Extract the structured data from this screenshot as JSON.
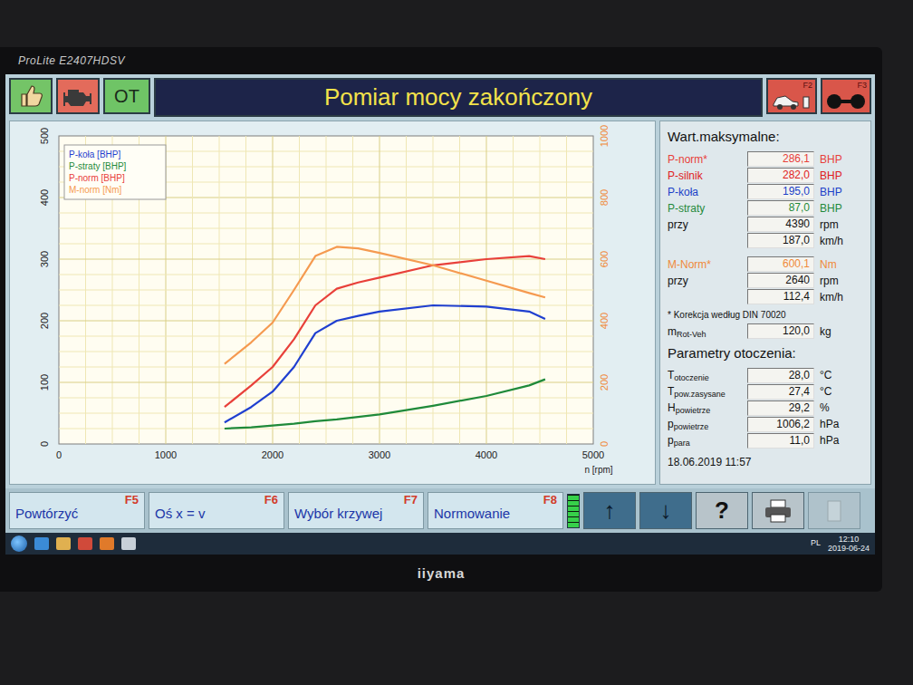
{
  "monitor": {
    "model": "ProLite E2407HDSV",
    "brand": "iiyama"
  },
  "toolbar": {
    "ot_label": "OT",
    "title": "Pomiar mocy zakończony",
    "f2_key": "F2",
    "f3_key": "F3"
  },
  "chart": {
    "y_ticks": [
      "0",
      "100",
      "200",
      "300",
      "400",
      "500"
    ],
    "y2_ticks": [
      "0",
      "200",
      "400",
      "600",
      "800",
      "1000"
    ],
    "x_ticks": [
      "0",
      "1000",
      "2000",
      "3000",
      "4000",
      "5000"
    ],
    "x_label": "n [rpm]",
    "rpm": [
      1550,
      1800,
      2000,
      2200,
      2400,
      2600,
      2800,
      3000,
      3500,
      4000,
      4400,
      4550
    ],
    "series": [
      {
        "legend": "P-koła [BHP]",
        "color": "#1f3fd0",
        "axis": "left",
        "values": [
          35,
          60,
          85,
          125,
          180,
          200,
          208,
          215,
          225,
          223,
          215,
          203
        ]
      },
      {
        "legend": "P-straty [BHP]",
        "color": "#1f8a3a",
        "axis": "left",
        "values": [
          25,
          27,
          30,
          33,
          37,
          40,
          44,
          48,
          62,
          78,
          95,
          105
        ]
      },
      {
        "legend": "P-norm [BHP]",
        "color": "#e8403a",
        "axis": "left",
        "values": [
          60,
          95,
          125,
          170,
          225,
          252,
          262,
          270,
          290,
          300,
          305,
          300
        ]
      },
      {
        "legend": "M-norm [Nm]",
        "color": "#f59a50",
        "axis": "right",
        "values": [
          260,
          330,
          394,
          500,
          610,
          640,
          635,
          620,
          580,
          530,
          490,
          476
        ]
      }
    ]
  },
  "maxima": {
    "title": "Wart.maksymalne:",
    "power_rows": [
      {
        "label": "P-norm*",
        "value": "286,1",
        "unit": "BHP",
        "color": "#e8403a"
      },
      {
        "label": "P-silnik",
        "value": "282,0",
        "unit": "BHP",
        "color": "#e02020"
      },
      {
        "label": "P-koła",
        "value": "195,0",
        "unit": "BHP",
        "color": "#1a3fc8"
      },
      {
        "label": "P-straty",
        "value": "87,0",
        "unit": "BHP",
        "color": "#1f8a3a"
      },
      {
        "label": "przy",
        "value": "4390",
        "unit": "rpm",
        "color": "#111111"
      },
      {
        "value": "187,0",
        "unit": "km/h",
        "color": "#111111"
      }
    ],
    "torque_rows": [
      {
        "label": "M-Norm*",
        "value": "600,1",
        "unit": "Nm",
        "color": "#f08a3a"
      },
      {
        "label": "przy",
        "value": "2640",
        "unit": "rpm",
        "color": "#111111"
      },
      {
        "value": "112,4",
        "unit": "km/h",
        "color": "#111111"
      }
    ],
    "note": "* Korekcja według DIN 70020",
    "mass": {
      "label": "m",
      "sub": "Rot-Veh",
      "value": "120,0",
      "unit": "kg"
    }
  },
  "ambient": {
    "title": "Parametry otoczenia:",
    "rows": [
      {
        "label": "T",
        "sub": "otoczenie",
        "value": "28,0",
        "unit": "°C"
      },
      {
        "label": "T",
        "sub": "pow.zasysane",
        "value": "27,4",
        "unit": "°C"
      },
      {
        "label": "H",
        "sub": "powietrze",
        "value": "29,2",
        "unit": "%"
      },
      {
        "label": "p",
        "sub": "powietrze",
        "value": "1006,2",
        "unit": "hPa"
      },
      {
        "label": "p",
        "sub": "para",
        "value": "11,0",
        "unit": "hPa"
      }
    ]
  },
  "timestamp": "18.06.2019 11:57",
  "function_keys": [
    {
      "label": "Powtórzyć",
      "key": "F5"
    },
    {
      "label": "Oś x = v",
      "key": "F6"
    },
    {
      "label": "Wybór krzywej",
      "key": "F7"
    },
    {
      "label": "Normowanie",
      "key": "F8"
    }
  ],
  "signal": {
    "level": 1.0
  },
  "icon_buttons": [
    {
      "kind": "glyph",
      "glyph": "↑",
      "disabled": false
    },
    {
      "kind": "glyph",
      "glyph": "↓",
      "disabled": false
    },
    {
      "kind": "glyph",
      "glyph": "?",
      "disabled": false
    },
    {
      "kind": "print",
      "disabled": false
    },
    {
      "kind": "blank",
      "disabled": true
    }
  ],
  "taskbar": {
    "language": "PL",
    "time": "12:10",
    "date": "2019-06-24"
  }
}
